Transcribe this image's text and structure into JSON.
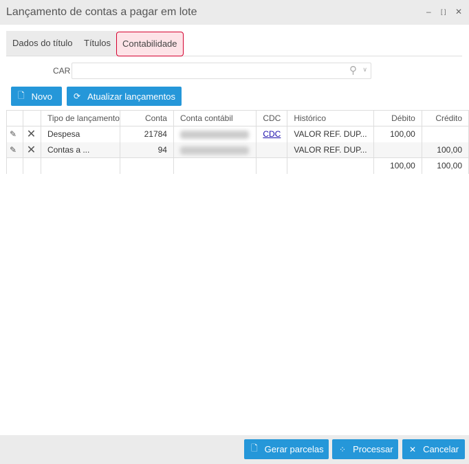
{
  "window": {
    "title": "Lançamento de contas a pagar em lote",
    "minimize": "‒",
    "maximize": "⛶",
    "close": "✕"
  },
  "tabs": [
    "Dados do título",
    "Títulos",
    "Contabilidade"
  ],
  "car": {
    "label": "CAR",
    "value": ""
  },
  "toolbar": {
    "novo": "Novo",
    "atualizar": "Atualizar lançamentos"
  },
  "table": {
    "headers": [
      "",
      "",
      "Tipo de lançamento",
      "Conta",
      "Conta contábil",
      "CDC",
      "Histórico",
      "Débito",
      "Crédito"
    ],
    "rows": [
      {
        "tipo": "Despesa",
        "conta": "21784",
        "cdc": "CDC",
        "historico": "VALOR REF. DUP...",
        "debito": "100,00",
        "credito": ""
      },
      {
        "tipo": "Contas a ...",
        "conta": "94",
        "cdc": "",
        "historico": "VALOR REF. DUP...",
        "debito": "",
        "credito": "100,00"
      }
    ],
    "totals": {
      "debito": "100,00",
      "credito": "100,00"
    }
  },
  "footer": {
    "gerar": "Gerar parcelas",
    "processar": "Processar",
    "cancelar": "Cancelar"
  }
}
